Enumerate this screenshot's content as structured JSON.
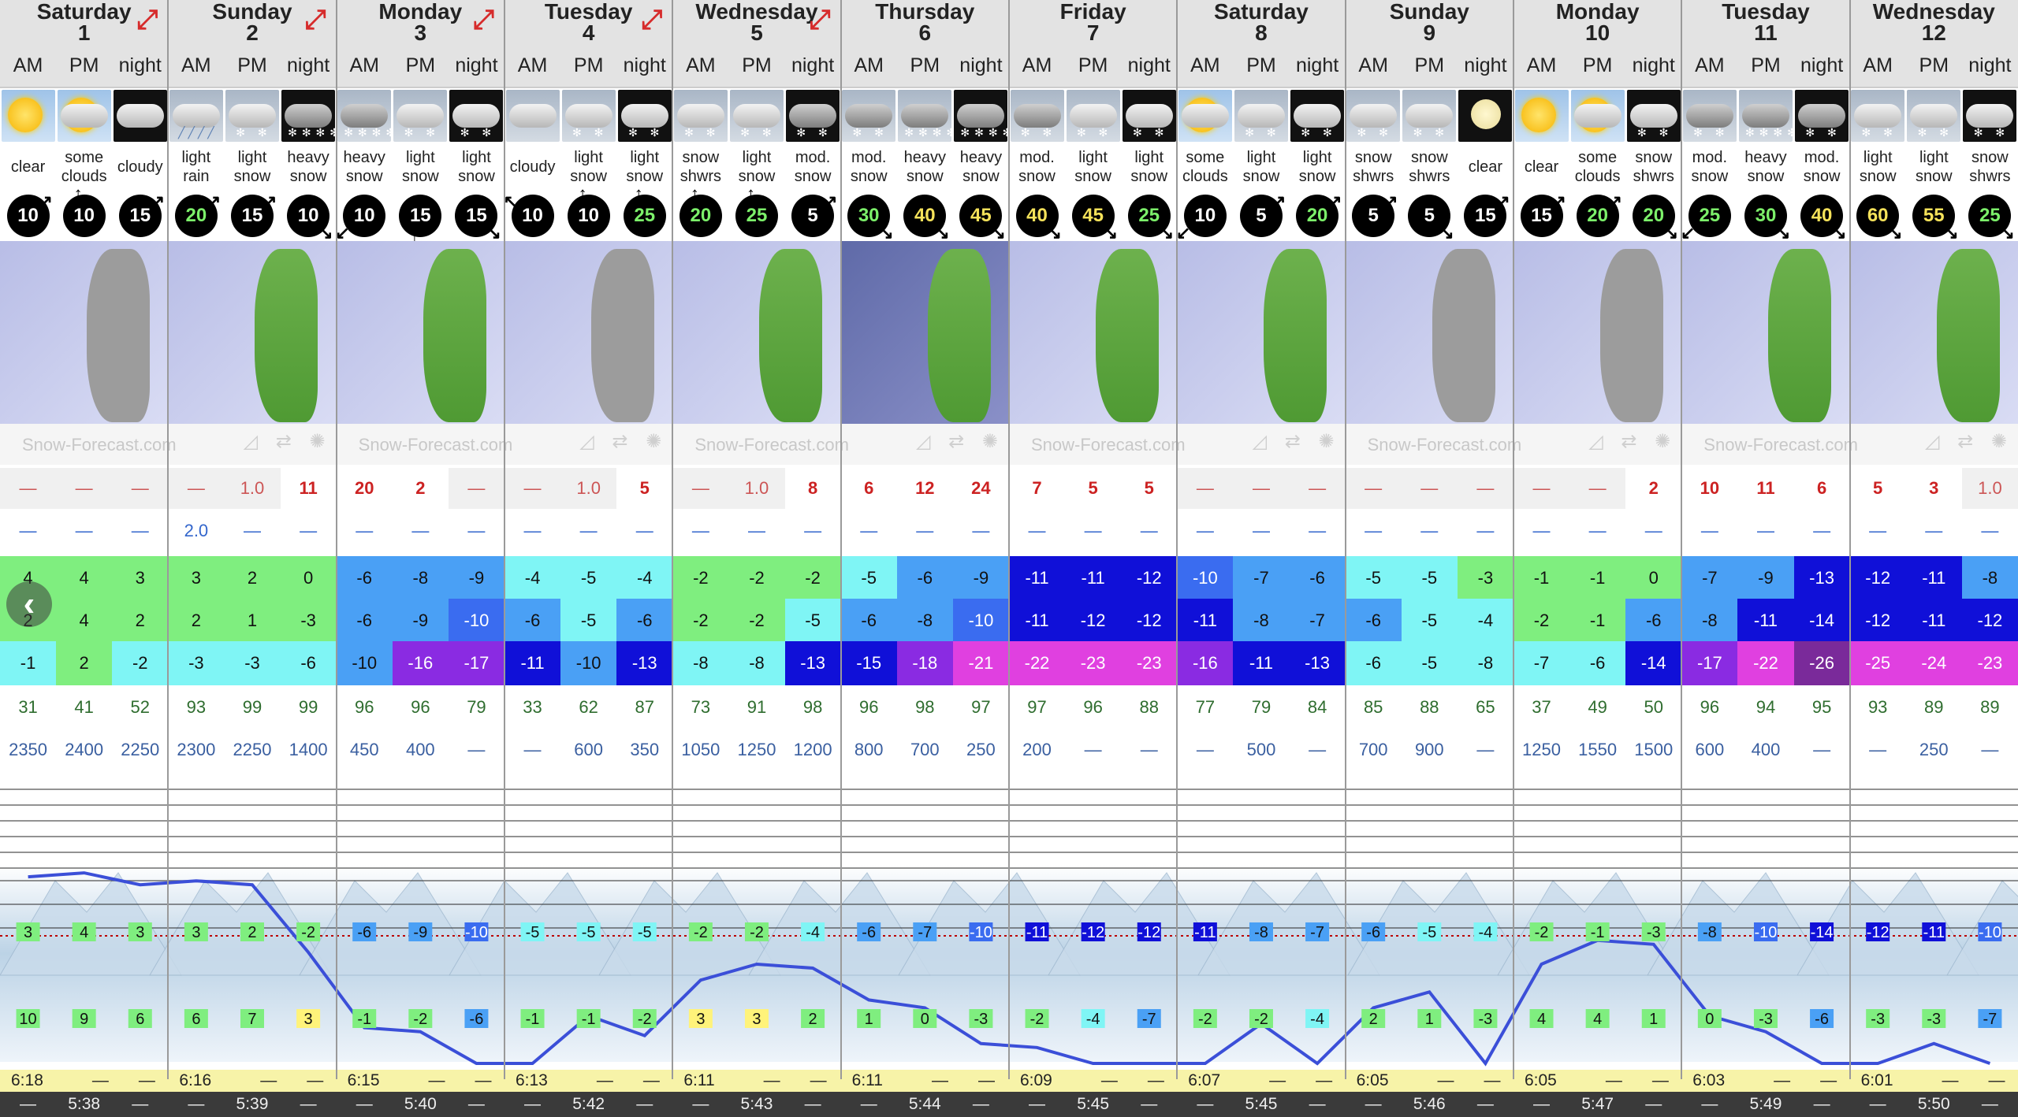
{
  "days": [
    {
      "name": "Saturday",
      "date": "1"
    },
    {
      "name": "Sunday",
      "date": "2"
    },
    {
      "name": "Monday",
      "date": "3"
    },
    {
      "name": "Tuesday",
      "date": "4"
    },
    {
      "name": "Wednesday",
      "date": "5"
    },
    {
      "name": "Thursday",
      "date": "6"
    },
    {
      "name": "Friday",
      "date": "7"
    },
    {
      "name": "Saturday",
      "date": "8"
    },
    {
      "name": "Sunday",
      "date": "9"
    },
    {
      "name": "Monday",
      "date": "10"
    },
    {
      "name": "Tuesday",
      "date": "11"
    },
    {
      "name": "Wednesday",
      "date": "12"
    }
  ],
  "periods": [
    "AM",
    "PM",
    "night"
  ],
  "weather": [
    [
      "clear",
      "some clouds",
      "cloudy"
    ],
    [
      "light rain",
      "light snow",
      "heavy snow"
    ],
    [
      "heavy snow",
      "light snow",
      "light snow"
    ],
    [
      "cloudy",
      "light snow",
      "light snow"
    ],
    [
      "snow shwrs",
      "light snow",
      "mod. snow"
    ],
    [
      "mod. snow",
      "heavy snow",
      "heavy snow"
    ],
    [
      "mod. snow",
      "light snow",
      "light snow"
    ],
    [
      "some clouds",
      "light snow",
      "light snow"
    ],
    [
      "snow shwrs",
      "snow shwrs",
      "clear"
    ],
    [
      "clear",
      "some clouds",
      "snow shwrs"
    ],
    [
      "mod. snow",
      "heavy snow",
      "mod. snow"
    ],
    [
      "light snow",
      "light snow",
      "snow shwrs"
    ]
  ],
  "weather_icons": [
    [
      "clear-day-icon",
      "some-clouds-day-icon",
      "cloudy-night-icon"
    ],
    [
      "light-rain-icon",
      "light-snow-icon",
      "heavy-snow-night-icon"
    ],
    [
      "heavy-snow-icon",
      "light-snow-icon",
      "light-snow-night-icon"
    ],
    [
      "cloudy-icon",
      "light-snow-icon",
      "light-snow-night-icon"
    ],
    [
      "snow-showers-icon",
      "light-snow-icon",
      "mod-snow-night-icon"
    ],
    [
      "mod-snow-icon",
      "heavy-snow-icon",
      "heavy-snow-night-icon"
    ],
    [
      "mod-snow-icon",
      "light-snow-icon",
      "light-snow-night-icon"
    ],
    [
      "some-clouds-day-icon",
      "light-snow-icon",
      "light-snow-night-icon"
    ],
    [
      "snow-showers-icon",
      "snow-showers-icon",
      "clear-night-icon"
    ],
    [
      "clear-day-icon",
      "some-clouds-day-icon",
      "snow-showers-night-icon"
    ],
    [
      "mod-snow-icon",
      "heavy-snow-icon",
      "mod-snow-night-icon"
    ],
    [
      "light-snow-icon",
      "light-snow-icon",
      "snow-showers-night-icon"
    ]
  ],
  "wind": [
    [
      "10",
      "10",
      "15"
    ],
    [
      "20",
      "15",
      "10"
    ],
    [
      "10",
      "15",
      "15"
    ],
    [
      "10",
      "10",
      "25"
    ],
    [
      "20",
      "25",
      "5"
    ],
    [
      "30",
      "40",
      "45"
    ],
    [
      "40",
      "45",
      "25"
    ],
    [
      "10",
      "5",
      "20"
    ],
    [
      "5",
      "5",
      "15"
    ],
    [
      "15",
      "20",
      "20"
    ],
    [
      "25",
      "30",
      "40"
    ],
    [
      "60",
      "55",
      "25"
    ]
  ],
  "wind_dir_arrows": [
    [
      "↗",
      "↑",
      "↗"
    ],
    [
      "↗",
      "↗",
      "↘"
    ],
    [
      "↙",
      "↓",
      "↘"
    ],
    [
      "↖",
      "↑",
      "↑"
    ],
    [
      "↑",
      "↑",
      "↗"
    ],
    [
      "↘",
      "↘",
      "↘"
    ],
    [
      "↘",
      "↘",
      "↘"
    ],
    [
      "↙",
      "↗",
      "↗"
    ],
    [
      "↗",
      "↘",
      "↗"
    ],
    [
      "↗",
      "↗",
      "↘"
    ],
    [
      "↙",
      "↘",
      "↘"
    ],
    [
      "↘",
      "↘",
      "↘"
    ]
  ],
  "credit": "Snow-Forecast.com",
  "snow": [
    [
      "—",
      "—",
      "—"
    ],
    [
      "—",
      "1.0",
      "11"
    ],
    [
      "20",
      "2",
      "—"
    ],
    [
      "—",
      "1.0",
      "5"
    ],
    [
      "—",
      "1.0",
      "8"
    ],
    [
      "6",
      "12",
      "24"
    ],
    [
      "7",
      "5",
      "5"
    ],
    [
      "—",
      "—",
      "—"
    ],
    [
      "—",
      "—",
      "—"
    ],
    [
      "—",
      "—",
      "2"
    ],
    [
      "10",
      "11",
      "6"
    ],
    [
      "5",
      "3",
      "1.0"
    ]
  ],
  "rain": [
    [
      "—",
      "—",
      "—"
    ],
    [
      "2.0",
      "—",
      "—"
    ],
    [
      "—",
      "—",
      "—"
    ],
    [
      "—",
      "—",
      "—"
    ],
    [
      "—",
      "—",
      "—"
    ],
    [
      "—",
      "—",
      "—"
    ],
    [
      "—",
      "—",
      "—"
    ],
    [
      "—",
      "—",
      "—"
    ],
    [
      "—",
      "—",
      "—"
    ],
    [
      "—",
      "—",
      "—"
    ],
    [
      "—",
      "—",
      "—"
    ],
    [
      "—",
      "—",
      "—"
    ]
  ],
  "temp_max": [
    [
      "4",
      "4",
      "3"
    ],
    [
      "3",
      "2",
      "0"
    ],
    [
      "-6",
      "-8",
      "-9"
    ],
    [
      "-4",
      "-5",
      "-4"
    ],
    [
      "-2",
      "-2",
      "-2"
    ],
    [
      "-5",
      "-6",
      "-9"
    ],
    [
      "-11",
      "-11",
      "-12"
    ],
    [
      "-10",
      "-7",
      "-6"
    ],
    [
      "-5",
      "-5",
      "-3"
    ],
    [
      "-1",
      "-1",
      "0"
    ],
    [
      "-7",
      "-9",
      "-13"
    ],
    [
      "-12",
      "-11",
      "-8"
    ]
  ],
  "temp_min": [
    [
      "2",
      "4",
      "2"
    ],
    [
      "2",
      "1",
      "-3"
    ],
    [
      "-6",
      "-9",
      "-10"
    ],
    [
      "-6",
      "-5",
      "-6"
    ],
    [
      "-2",
      "-2",
      "-5"
    ],
    [
      "-6",
      "-8",
      "-10"
    ],
    [
      "-11",
      "-12",
      "-12"
    ],
    [
      "-11",
      "-8",
      "-7"
    ],
    [
      "-6",
      "-5",
      "-4"
    ],
    [
      "-2",
      "-1",
      "-6"
    ],
    [
      "-8",
      "-11",
      "-14"
    ],
    [
      "-12",
      "-11",
      "-12"
    ]
  ],
  "temp_chill": [
    [
      "-1",
      "2",
      "-2"
    ],
    [
      "-3",
      "-3",
      "-6"
    ],
    [
      "-10",
      "-16",
      "-17"
    ],
    [
      "-11",
      "-10",
      "-13"
    ],
    [
      "-8",
      "-8",
      "-13"
    ],
    [
      "-15",
      "-18",
      "-21"
    ],
    [
      "-22",
      "-23",
      "-23"
    ],
    [
      "-16",
      "-11",
      "-13"
    ],
    [
      "-6",
      "-5",
      "-8"
    ],
    [
      "-7",
      "-6",
      "-14"
    ],
    [
      "-17",
      "-22",
      "-26"
    ],
    [
      "-25",
      "-24",
      "-23"
    ]
  ],
  "humidity": [
    [
      "31",
      "41",
      "52"
    ],
    [
      "93",
      "99",
      "99"
    ],
    [
      "96",
      "96",
      "79"
    ],
    [
      "33",
      "62",
      "87"
    ],
    [
      "73",
      "91",
      "98"
    ],
    [
      "96",
      "98",
      "97"
    ],
    [
      "97",
      "96",
      "88"
    ],
    [
      "77",
      "79",
      "84"
    ],
    [
      "85",
      "88",
      "65"
    ],
    [
      "37",
      "49",
      "50"
    ],
    [
      "96",
      "94",
      "95"
    ],
    [
      "93",
      "89",
      "89"
    ]
  ],
  "freezing_level": [
    [
      "2350",
      "2400",
      "2250"
    ],
    [
      "2300",
      "2250",
      "1400"
    ],
    [
      "450",
      "400",
      "—"
    ],
    [
      "—",
      "600",
      "350"
    ],
    [
      "1050",
      "1250",
      "1200"
    ],
    [
      "800",
      "700",
      "250"
    ],
    [
      "200",
      "—",
      "—"
    ],
    [
      "—",
      "500",
      "—"
    ],
    [
      "700",
      "900",
      "—"
    ],
    [
      "1250",
      "1550",
      "1500"
    ],
    [
      "600",
      "400",
      "—"
    ],
    [
      "—",
      "250",
      "—"
    ]
  ],
  "graph_top_temps": [
    [
      "3",
      "4",
      "3"
    ],
    [
      "3",
      "2",
      "-2"
    ],
    [
      "-6",
      "-9",
      "-10"
    ],
    [
      "-5",
      "-5",
      "-5"
    ],
    [
      "-2",
      "-2",
      "-4"
    ],
    [
      "-6",
      "-7",
      "-10"
    ],
    [
      "-11",
      "-12",
      "-12"
    ],
    [
      "-11",
      "-8",
      "-7"
    ],
    [
      "-6",
      "-5",
      "-4"
    ],
    [
      "-2",
      "-1",
      "-3"
    ],
    [
      "-8",
      "-10",
      "-14"
    ],
    [
      "-12",
      "-11",
      "-10"
    ]
  ],
  "graph_bottom_temps": [
    [
      "10",
      "9",
      "6"
    ],
    [
      "6",
      "7",
      "3"
    ],
    [
      "-1",
      "-2",
      "-6"
    ],
    [
      "-1",
      "-1",
      "-2"
    ],
    [
      "3",
      "3",
      "2"
    ],
    [
      "1",
      "0",
      "-3"
    ],
    [
      "-2",
      "-4",
      "-7"
    ],
    [
      "-2",
      "-2",
      "-4"
    ],
    [
      "2",
      "1",
      "-3"
    ],
    [
      "4",
      "4",
      "1"
    ],
    [
      "0",
      "-3",
      "-6"
    ],
    [
      "-3",
      "-3",
      "-7"
    ]
  ],
  "freezing_level_line": [
    2350,
    2400,
    2250,
    2300,
    2250,
    1400,
    450,
    400,
    0,
    0,
    600,
    350,
    1050,
    1250,
    1200,
    800,
    700,
    250,
    200,
    0,
    0,
    0,
    500,
    0,
    700,
    900,
    0,
    1250,
    1550,
    1500,
    600,
    400,
    0,
    0,
    250,
    0
  ],
  "sunrise": [
    "6:18",
    "6:16",
    "6:15",
    "6:13",
    "6:11",
    "6:11",
    "6:09",
    "6:07",
    "6:05",
    "6:05",
    "6:03",
    "6:01"
  ],
  "sunset": [
    "5:38",
    "5:39",
    "5:40",
    "5:42",
    "5:43",
    "5:44",
    "5:45",
    "5:45",
    "5:46",
    "5:47",
    "5:49",
    "5:50"
  ],
  "dash": "—",
  "nav": {
    "prev": "‹"
  },
  "colors": {
    "green": "#7fee7f",
    "lightgreen": "#a5f2a5",
    "cyan": "#7ff5f5",
    "blue": "#4aa0f5",
    "midblue": "#3a6cf0",
    "darkblue": "#1010d8",
    "navy": "#0000c0",
    "purple": "#8a2be2",
    "magenta": "#e040e0",
    "darkpurple": "#7a2a9a",
    "line": "#3b4fd8",
    "expand": "#d62b2b"
  }
}
